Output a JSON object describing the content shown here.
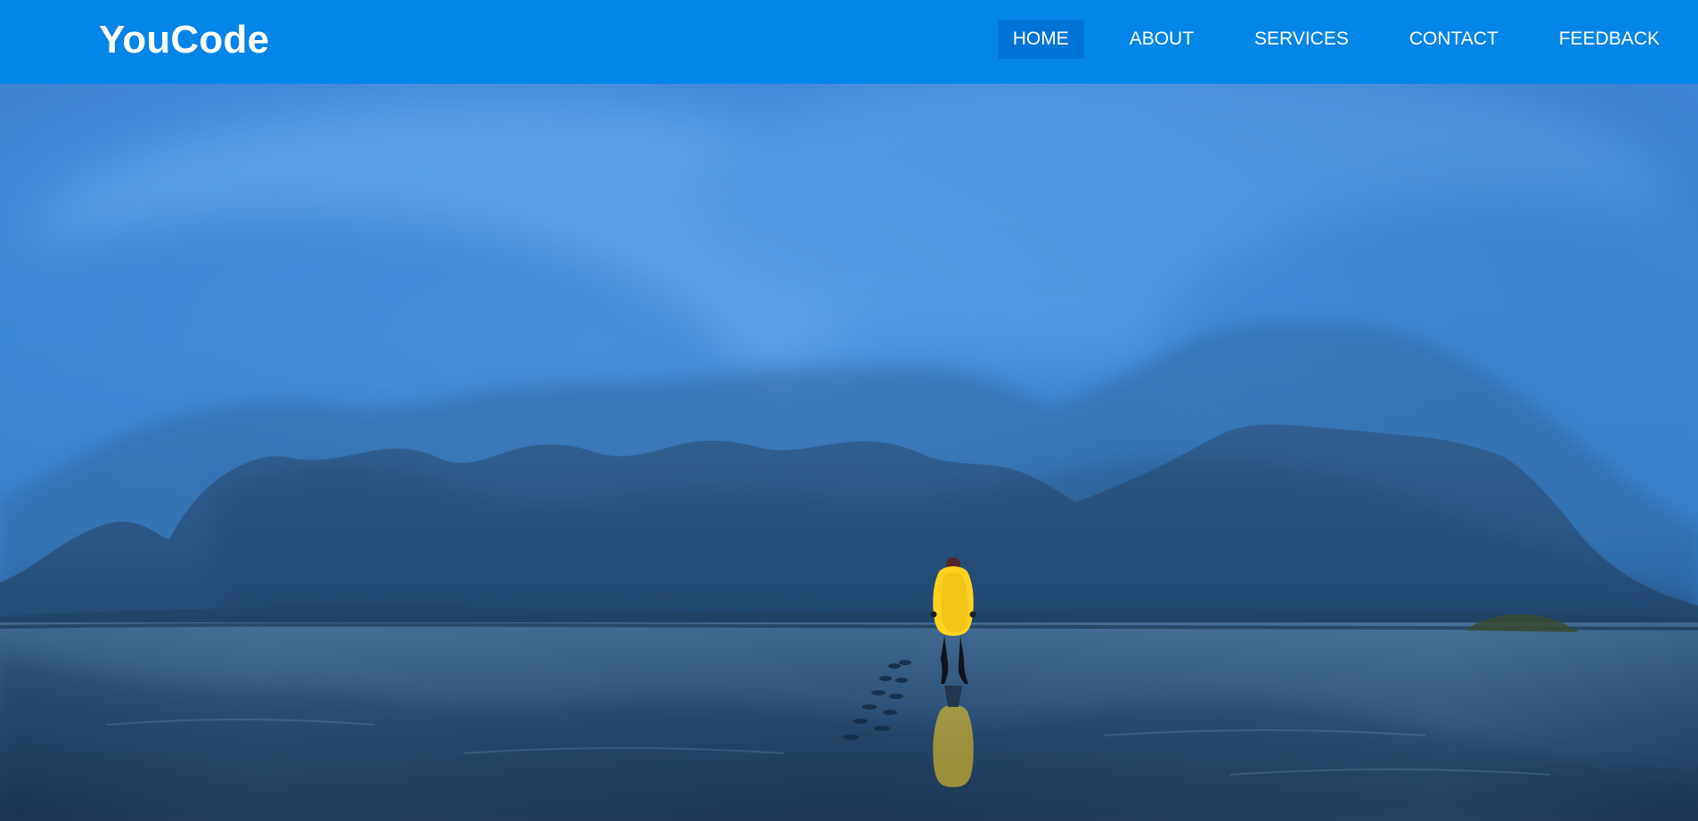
{
  "header": {
    "brand": "YouCode",
    "nav": [
      {
        "label": "HOME",
        "active": true
      },
      {
        "label": "ABOUT",
        "active": false
      },
      {
        "label": "SERVICES",
        "active": false
      },
      {
        "label": "CONTACT",
        "active": false
      },
      {
        "label": "FEEDBACK",
        "active": false
      }
    ]
  },
  "colors": {
    "navbar_bg": "#0285e8",
    "nav_active_bg": "#0074d6",
    "text": "#ffffff"
  },
  "hero": {
    "image_subject": "misty-mountains-and-beach-with-person-in-yellow-jacket"
  }
}
